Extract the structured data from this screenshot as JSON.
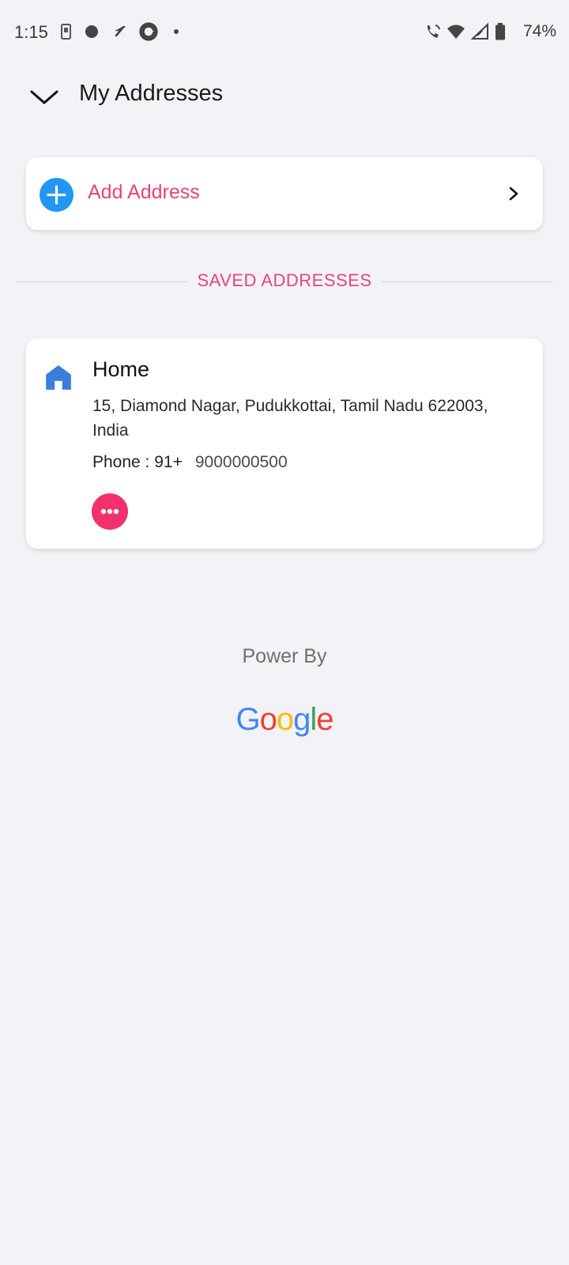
{
  "status_bar": {
    "time": "1:15",
    "battery": "74%",
    "icons": [
      "sim-card-icon",
      "circle-dot-icon",
      "fanatic-icon",
      "refresh-app-icon",
      "dot-icon",
      "wifi-calling-icon",
      "wifi-icon",
      "signal-icon",
      "battery-icon"
    ]
  },
  "header": {
    "title": "My Addresses",
    "back_icon": "chevron-down-icon"
  },
  "add_address": {
    "label": "Add Address",
    "icon": "plus-circle-icon",
    "chevron": "chevron-right-icon"
  },
  "section": {
    "label": "SAVED ADDRESSES"
  },
  "addresses": [
    {
      "label": "Home",
      "icon": "home-icon",
      "address": "15, Diamond Nagar, Pudukkottai, Tamil Nadu 622003, India",
      "phone_label": "Phone : 91+",
      "phone_number": "9000000500",
      "more_icon": "more-horizontal-icon"
    }
  ],
  "footer": {
    "power_by": "Power By",
    "logo_text": "Google"
  },
  "colors": {
    "accent_pink": "#e8457a",
    "more_button": "#f2306e",
    "add_blue": "#2196f3",
    "home_blue": "#3b7ddd",
    "background": "#f2f2f7"
  }
}
